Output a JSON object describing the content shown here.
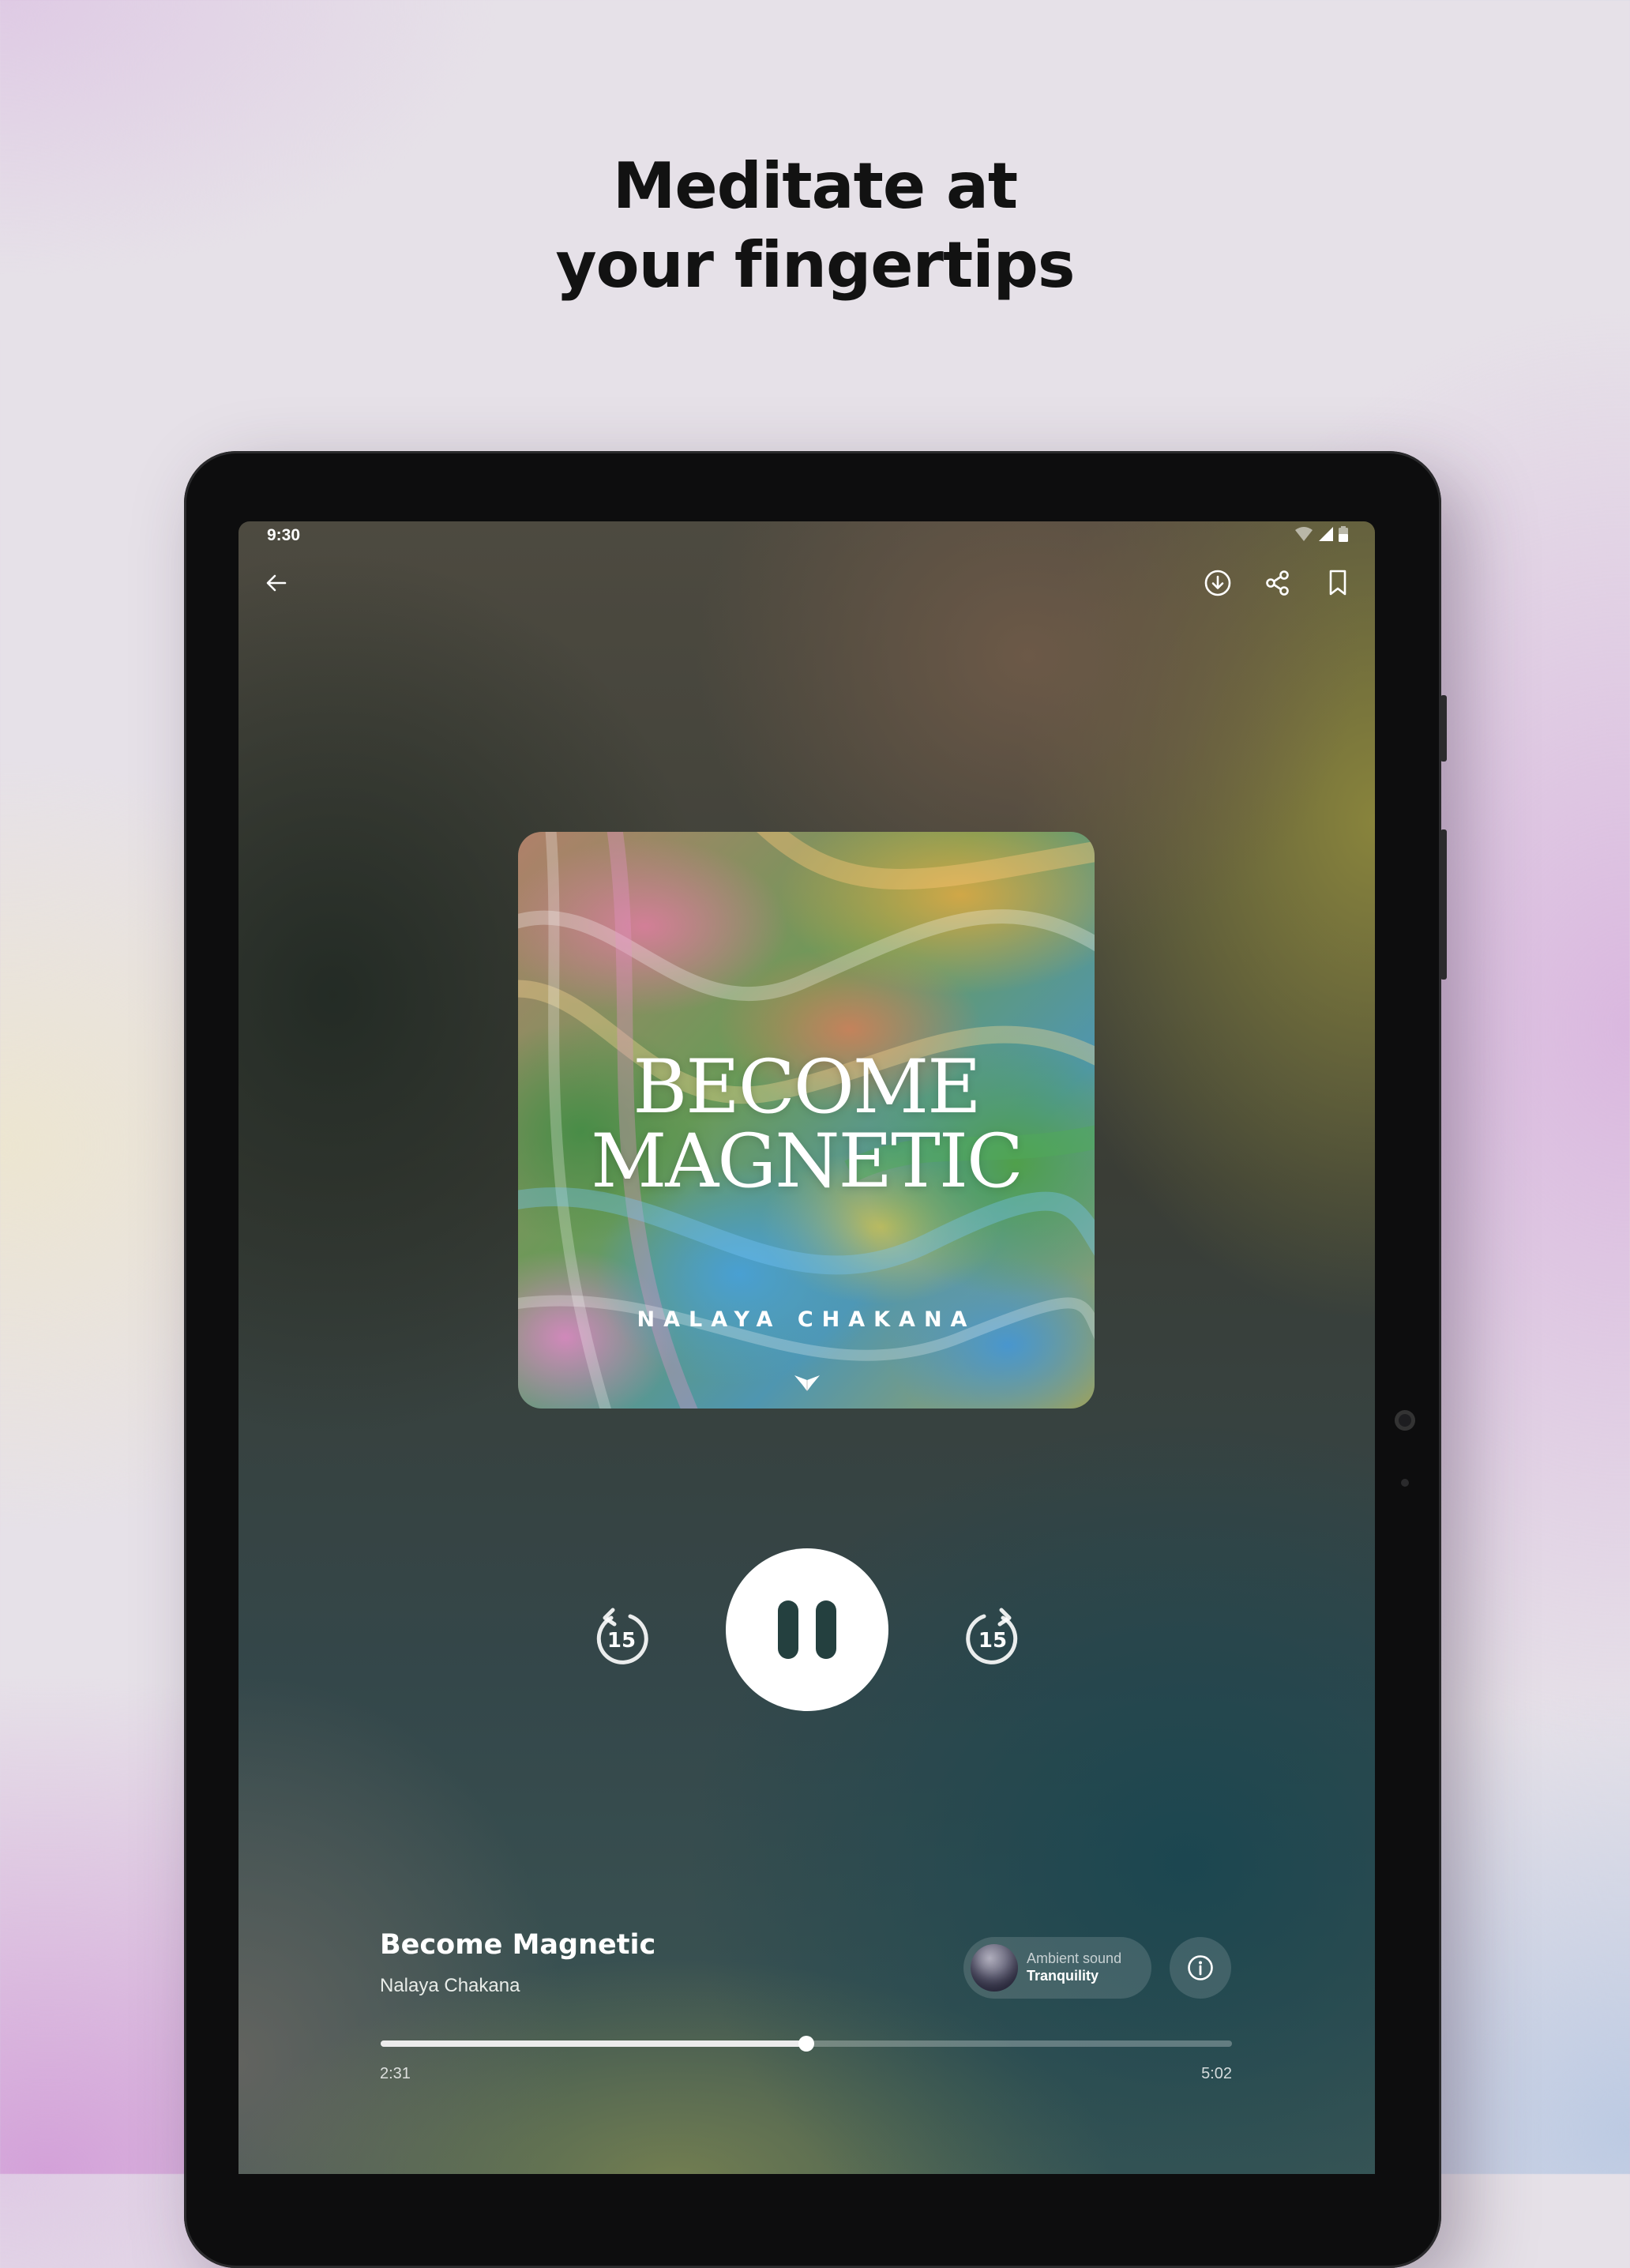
{
  "headline": {
    "line1": "Meditate at",
    "line2": "your fingertips"
  },
  "status_bar": {
    "time": "9:30",
    "icons": [
      "wifi-icon",
      "signal-icon",
      "battery-icon"
    ]
  },
  "top_bar": {
    "back_icon": "arrow-left-icon",
    "actions": [
      "download-icon",
      "share-icon",
      "bookmark-icon"
    ]
  },
  "artwork": {
    "title_line1": "BECOME",
    "title_line2": "MAGNETIC",
    "author": "NALAYA CHAKANA",
    "logo_icon": "brand-logo-icon"
  },
  "controls": {
    "rewind_seconds": "15",
    "forward_seconds": "15",
    "state": "playing",
    "center_icon": "pause-icon"
  },
  "track": {
    "title": "Become Magnetic",
    "artist": "Nalaya Chakana"
  },
  "ambient": {
    "label": "Ambient sound",
    "value": "Tranquility",
    "info_icon": "info-icon"
  },
  "progress": {
    "elapsed": "2:31",
    "total": "5:02",
    "fraction": 0.5
  },
  "colors": {
    "headline_text": "#121212",
    "accent_dark": "#24403f",
    "page_background": "#e6e1e8"
  }
}
